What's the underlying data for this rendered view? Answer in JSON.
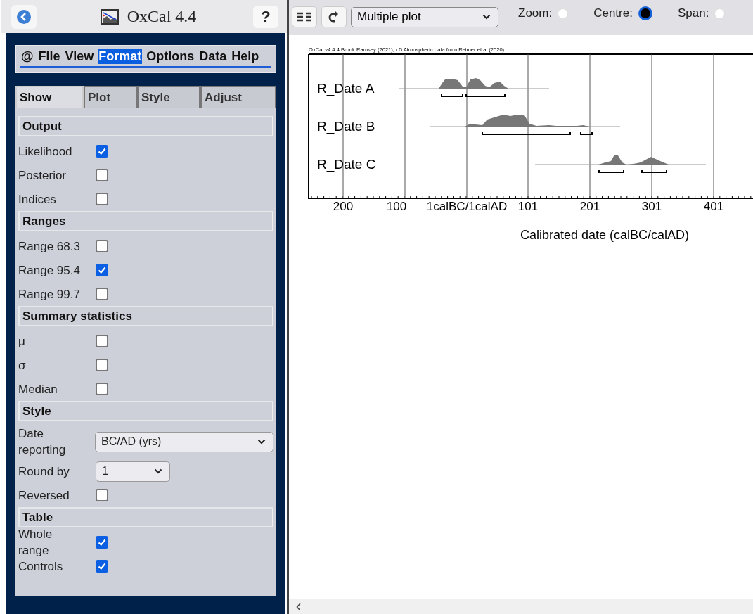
{
  "app": {
    "title": "OxCal 4.4",
    "help": "?"
  },
  "menu": [
    {
      "label": "@",
      "selected": false
    },
    {
      "label": "File",
      "selected": false
    },
    {
      "label": "View",
      "selected": false
    },
    {
      "label": "Format",
      "selected": true
    },
    {
      "label": "Options",
      "selected": false
    },
    {
      "label": "Data",
      "selected": false
    },
    {
      "label": "Help",
      "selected": false
    }
  ],
  "tabs": [
    {
      "label": "Show",
      "selected": true
    },
    {
      "label": "Plot",
      "selected": false
    },
    {
      "label": "Style",
      "selected": false
    },
    {
      "label": "Adjust",
      "selected": false
    }
  ],
  "sections": [
    {
      "title": "Output",
      "rows": [
        {
          "kind": "checkbox",
          "label": "Likelihood",
          "checked": true
        },
        {
          "kind": "checkbox",
          "label": "Posterior",
          "checked": false
        },
        {
          "kind": "checkbox",
          "label": "Indices",
          "checked": false
        }
      ]
    },
    {
      "title": "Ranges",
      "rows": [
        {
          "kind": "checkbox",
          "label": "Range 68.3",
          "checked": false
        },
        {
          "kind": "checkbox",
          "label": "Range 95.4",
          "checked": true
        },
        {
          "kind": "checkbox",
          "label": "Range 99.7",
          "checked": false
        }
      ]
    },
    {
      "title": "Summary statistics",
      "rows": [
        {
          "kind": "checkbox",
          "label": "μ",
          "checked": false
        },
        {
          "kind": "checkbox",
          "label": "σ",
          "checked": false
        },
        {
          "kind": "checkbox",
          "label": "Median",
          "checked": false
        }
      ]
    },
    {
      "title": "Style",
      "rows": [
        {
          "kind": "wide-select",
          "label": "Date reporting",
          "value": "BC/AD (yrs)"
        },
        {
          "kind": "select",
          "label": "Round by",
          "value": "1"
        },
        {
          "kind": "checkbox",
          "label": "Reversed",
          "checked": false
        }
      ]
    },
    {
      "title": "Table",
      "rows": [
        {
          "kind": "checkbox",
          "label": "Whole range",
          "checked": true
        },
        {
          "kind": "checkbox",
          "label": "Controls",
          "checked": true
        }
      ]
    }
  ],
  "toolbar": {
    "plot_type": "Multiple plot",
    "modes": [
      {
        "label": "Zoom:",
        "selected": false
      },
      {
        "label": "Centre:",
        "selected": true
      },
      {
        "label": "Span:",
        "selected": false
      }
    ]
  },
  "plot": {
    "title": "OxCal v4.4.4 Bronk Ramsey (2021); r:5 Atmospheric data from Reimer et al (2020)",
    "rows": [
      {
        "label": "R_Date A"
      },
      {
        "label": "R_Date B"
      },
      {
        "label": "R_Date C"
      }
    ],
    "ticks": [
      "200",
      "100",
      "1calBC/1calAD",
      "101",
      "201",
      "301",
      "401"
    ],
    "xlabel": "Calibrated date (calBC/calAD)"
  }
}
